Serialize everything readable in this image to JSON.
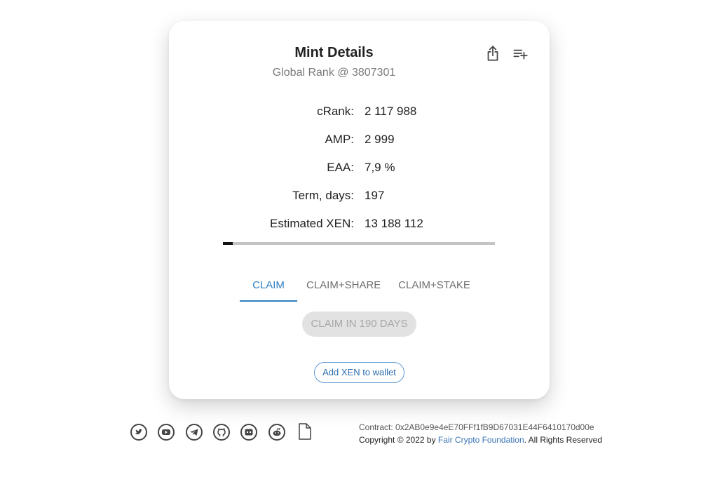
{
  "card": {
    "title": "Mint Details",
    "global_rank": "Global Rank @ 3807301",
    "stats": [
      {
        "label": "cRank:",
        "value": "2 117 988"
      },
      {
        "label": "AMP:",
        "value": "2 999"
      },
      {
        "label": "EAA:",
        "value": "7,9 %"
      },
      {
        "label": "Term, days:",
        "value": "197"
      },
      {
        "label": "Estimated XEN:",
        "value": "13 188 112"
      }
    ],
    "progress_fraction": 0.035,
    "tabs": [
      {
        "label": "CLAIM",
        "active": true
      },
      {
        "label": "CLAIM+SHARE",
        "active": false
      },
      {
        "label": "CLAIM+STAKE",
        "active": false
      }
    ],
    "claim_button": "CLAIM IN 190 DAYS",
    "wallet_button": "Add XEN to wallet",
    "icons": {
      "share": "share-icon",
      "playlist_add": "playlist-add-icon"
    }
  },
  "footer": {
    "icons": [
      "twitter-icon",
      "youtube-icon",
      "telegram-icon",
      "github-icon",
      "discord-icon",
      "reddit-icon",
      "document-icon"
    ],
    "contract": "Contract: 0x2AB0e9e4eE70FFf1fB9D67031E44F6410170d00e",
    "copyright_prefix": "Copyright © 2022 by ",
    "foundation_link": "Fair Crypto Foundation",
    "copyright_suffix": ". All Rights Reserved"
  },
  "colors": {
    "accent": "#2f7fc1",
    "progress_fill": "#111111",
    "progress_track": "#c4c4c4"
  }
}
